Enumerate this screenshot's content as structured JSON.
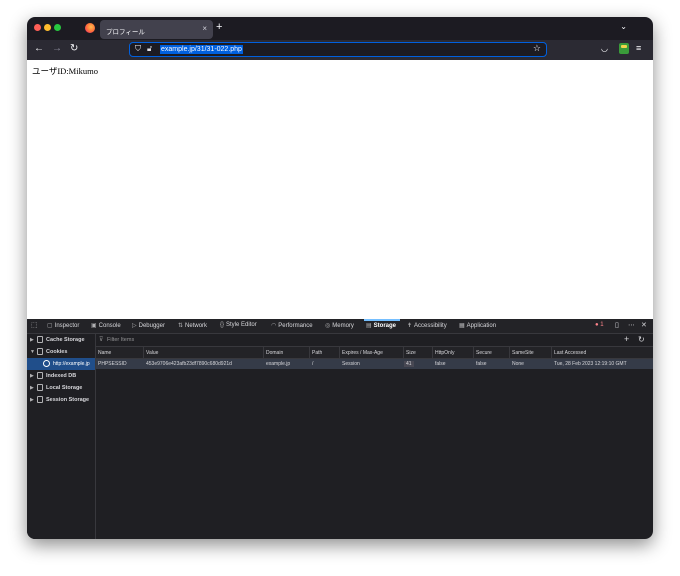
{
  "browser": {
    "tab_title": "プロフィール",
    "tab_close": "×",
    "new_tab": "+",
    "tab_list": "⌄",
    "url": "example.jp/31/31-022.php"
  },
  "page": {
    "text": "ユーザID:Mikumo"
  },
  "devtools": {
    "tabs": [
      {
        "label": "Inspector",
        "icon": "inspector-icon"
      },
      {
        "label": "Console",
        "icon": "console-icon"
      },
      {
        "label": "Debugger",
        "icon": "debugger-icon"
      },
      {
        "label": "Network",
        "icon": "network-icon"
      },
      {
        "label": "Style Editor",
        "icon": "style-editor-icon"
      },
      {
        "label": "Performance",
        "icon": "performance-icon"
      },
      {
        "label": "Memory",
        "icon": "memory-icon"
      },
      {
        "label": "Storage",
        "icon": "storage-icon"
      },
      {
        "label": "Accessibility",
        "icon": "accessibility-icon"
      },
      {
        "label": "Application",
        "icon": "application-icon"
      }
    ],
    "active_tab": "Storage",
    "error_count": "1",
    "sidebar": [
      {
        "label": "Cache Storage",
        "expanded": false
      },
      {
        "label": "Cookies",
        "expanded": true
      },
      {
        "label": "http://example.jp",
        "selected": true
      },
      {
        "label": "Indexed DB",
        "expanded": false
      },
      {
        "label": "Local Storage",
        "expanded": false
      },
      {
        "label": "Session Storage",
        "expanded": false
      }
    ],
    "filter_placeholder": "Filter Items",
    "columns": [
      "Name",
      "Value",
      "Domain",
      "Path",
      "Expires / Max-Age",
      "Size",
      "HttpOnly",
      "Secure",
      "SameSite",
      "Last Accessed"
    ],
    "rows": [
      [
        "PHPSESSID",
        "453e9706e423afb23df7890c680d921d",
        "example.jp",
        "/",
        "Session",
        "41",
        "false",
        "false",
        "None",
        "Tue, 28 Feb 2023 12:19:10 GMT"
      ]
    ]
  },
  "colors": {
    "accent": "#0060df",
    "toolbar_bg": "#2b2a33",
    "titlebar_bg": "#1c1b22",
    "devtools_bg": "#1f1f23",
    "selected_row": "#353b48",
    "selected_tree": "#204e8a",
    "error": "#ff848b"
  }
}
